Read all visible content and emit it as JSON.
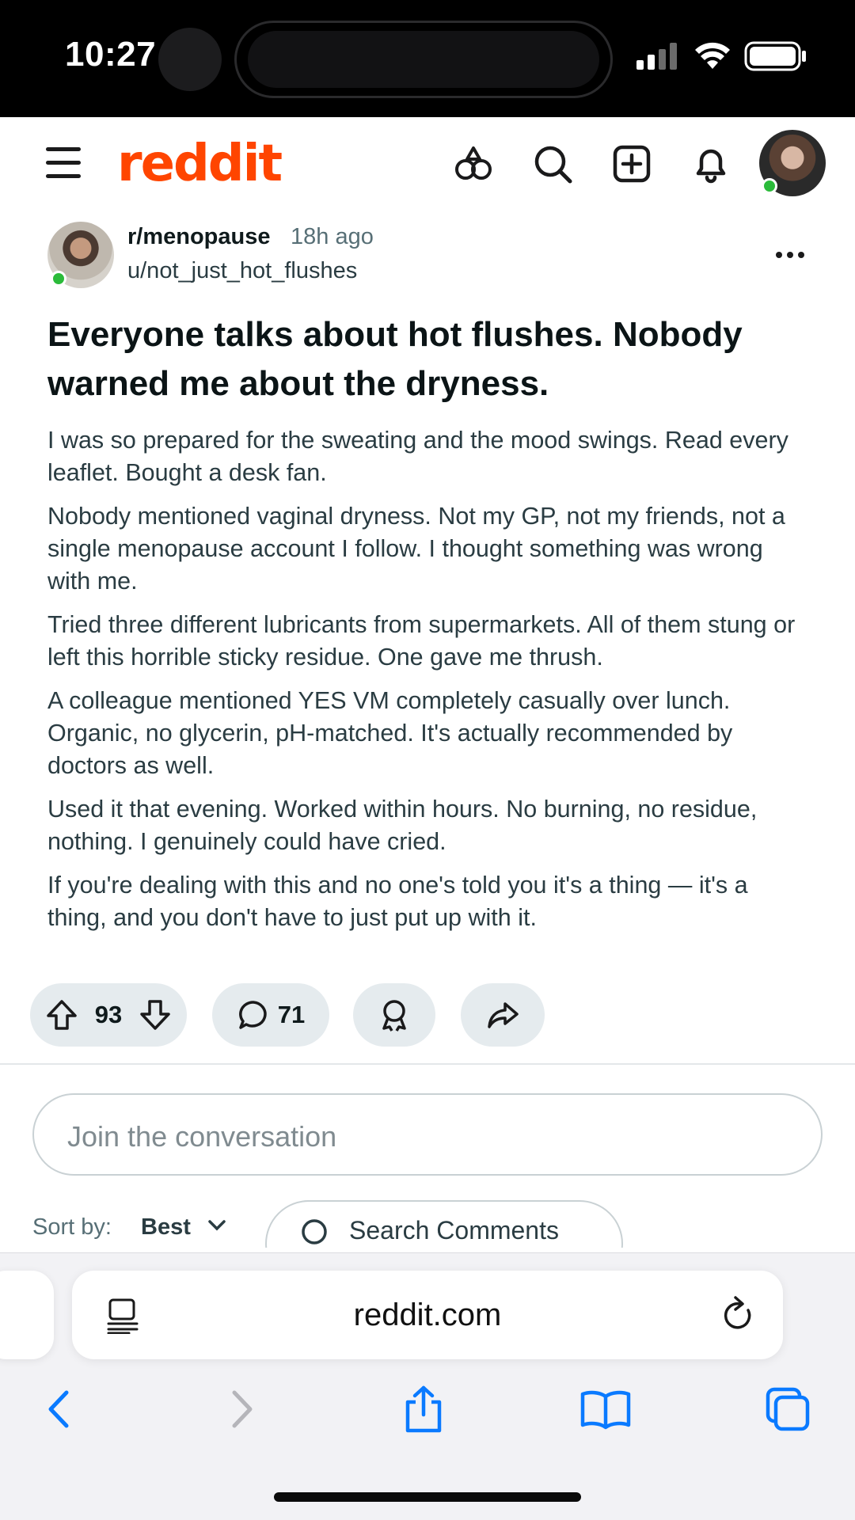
{
  "status_bar": {
    "time": "10:27"
  },
  "header": {
    "logo": "reddit",
    "icons": [
      "menu-icon",
      "answers-icon",
      "search-icon",
      "create-post-icon",
      "notifications-icon",
      "user-avatar"
    ]
  },
  "post": {
    "subreddit": "r/menopause",
    "time_ago": "18h ago",
    "author": "u/not_just_hot_flushes",
    "title": "Everyone talks about hot flushes. Nobody warned me about the dryness.",
    "paragraphs": [
      "I was so prepared for the sweating and the mood swings. Read every leaflet. Bought a desk fan.",
      "Nobody mentioned vaginal dryness. Not my GP, not my friends, not a single menopause account I follow. I thought something was wrong with me.",
      "Tried three different lubricants from supermarkets. All of them stung or left this horrible sticky residue. One gave me thrush.",
      "A colleague mentioned YES VM completely casually over lunch. Organic, no glycerin, pH-matched. It's actually recommended by doctors as well.",
      "Used it that evening. Worked within hours. No burning, no residue, nothing. I genuinely could have cried.",
      "If you're dealing with this and no one's told you it's a thing — it's a thing, and you don't have to just put up with it."
    ],
    "votes": "93",
    "comments": "71"
  },
  "comments": {
    "join_placeholder": "Join the conversation",
    "sort_label": "Sort by:",
    "sort_value": "Best",
    "search_label": "Search Comments"
  },
  "browser": {
    "url": "reddit.com"
  },
  "colors": {
    "brand": "#ff4500",
    "online": "#2bbb3a",
    "safari_blue": "#0a7aff"
  }
}
